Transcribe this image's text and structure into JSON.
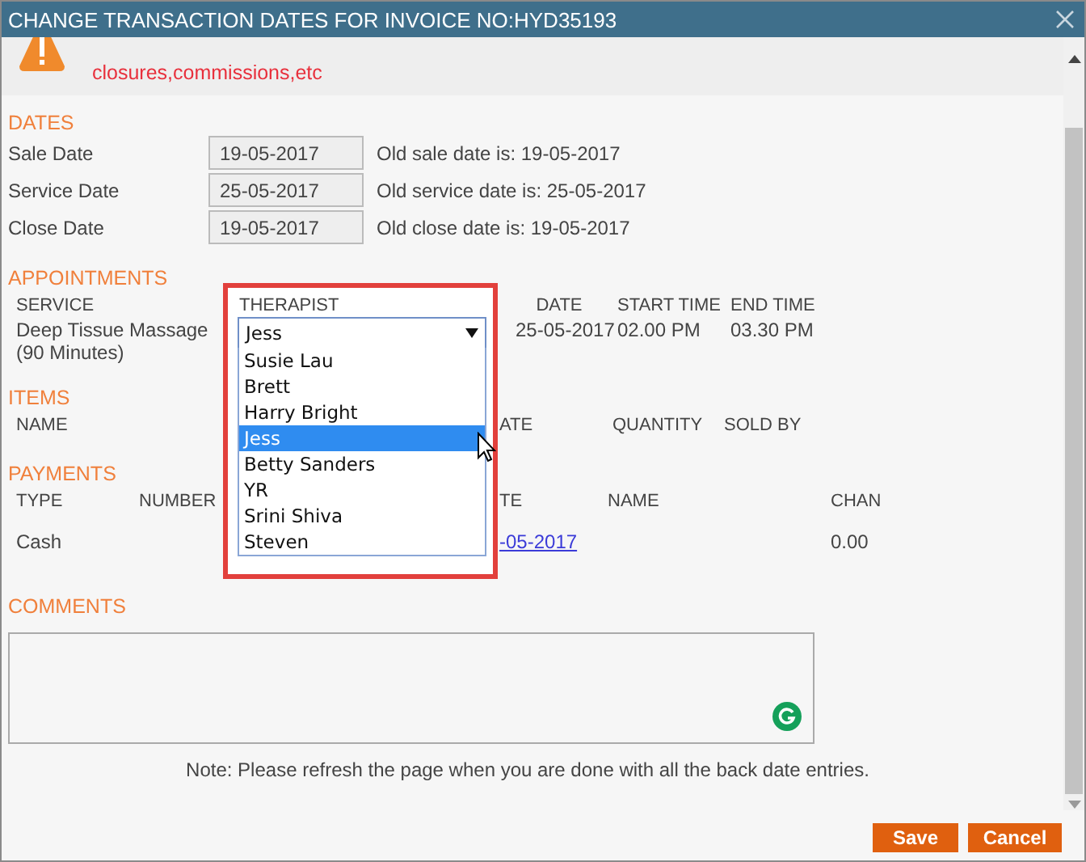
{
  "window": {
    "title": "CHANGE TRANSACTION DATES FOR INVOICE NO:HYD35193"
  },
  "warning": {
    "text": "closures,commissions,etc"
  },
  "dates": {
    "heading": "DATES",
    "fields": [
      {
        "label": "Sale Date",
        "value": "19-05-2017",
        "note": "Old sale date is: 19-05-2017"
      },
      {
        "label": "Service Date",
        "value": "25-05-2017",
        "note": "Old service date is: 25-05-2017"
      },
      {
        "label": "Close Date",
        "value": "19-05-2017",
        "note": "Old close date is: 19-05-2017"
      }
    ]
  },
  "appointments": {
    "heading": "APPOINTMENTS",
    "columns": [
      "SERVICE",
      "THERAPIST",
      "DATE",
      "START TIME",
      "END TIME"
    ],
    "rows": [
      {
        "service": "Deep Tissue Massage (90 Minutes)",
        "therapist": "Jess",
        "date": "25-05-2017",
        "start_time": "02.00 PM",
        "end_time": "03.30 PM"
      }
    ],
    "therapist_options": [
      {
        "label": "Susie Lau",
        "selected": false
      },
      {
        "label": "Brett",
        "selected": false
      },
      {
        "label": "Harry Bright",
        "selected": false
      },
      {
        "label": "Jess",
        "selected": true
      },
      {
        "label": "Betty Sanders",
        "selected": false
      },
      {
        "label": "YR",
        "selected": false
      },
      {
        "label": "Srini Shiva",
        "selected": false
      },
      {
        "label": "Steven",
        "selected": false
      }
    ]
  },
  "items": {
    "heading": "ITEMS",
    "columns": [
      "NAME",
      "ATE",
      "QUANTITY",
      "SOLD BY"
    ]
  },
  "payments": {
    "heading": "PAYMENTS",
    "columns": [
      "TYPE",
      "NUMBER",
      "TE",
      "NAME",
      "CHAN"
    ],
    "rows": [
      {
        "type": "Cash",
        "date": "-05-2017",
        "change": "0.00"
      }
    ]
  },
  "comments": {
    "heading": "COMMENTS"
  },
  "note": "Note: Please refresh the page when you are done with all the back date entries.",
  "buttons": [
    {
      "label": "Save"
    },
    {
      "label": "Cancel"
    }
  ]
}
